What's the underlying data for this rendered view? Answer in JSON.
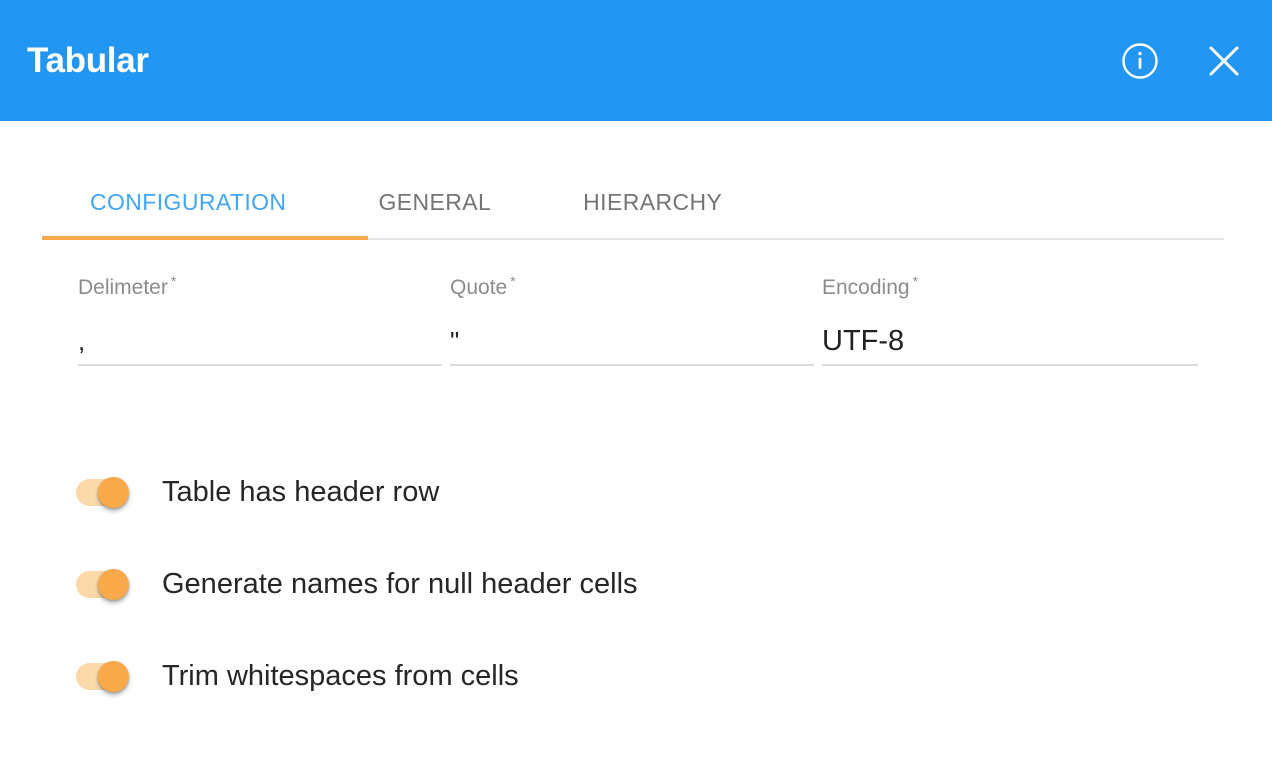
{
  "window": {
    "title": "Tabular",
    "info_icon": "info-circle-icon",
    "close_icon": "close-icon",
    "header_color": "#2196f3"
  },
  "tabs": [
    {
      "label": "CONFIGURATION",
      "active": true
    },
    {
      "label": "GENERAL",
      "active": false
    },
    {
      "label": "HIERARCHY",
      "active": false
    }
  ],
  "accent": {
    "tab_indicator_color": "#f9a94a",
    "active_tab_text_color": "#42a5f5",
    "inactive_tab_text_color": "#757575",
    "toggle_on_color": "#f9a94a",
    "toggle_track_color": "#fbd9a8"
  },
  "fields": [
    {
      "label": "Delimeter",
      "required_marker": "*",
      "value": ",",
      "placeholder": ""
    },
    {
      "label": "Quote",
      "required_marker": "*",
      "value": "\"",
      "placeholder": ""
    },
    {
      "label": "Encoding",
      "required_marker": "*",
      "value": "UTF-8",
      "placeholder": ""
    }
  ],
  "toggles": [
    {
      "label": "Table has header row",
      "on": true
    },
    {
      "label": "Generate names for null header cells",
      "on": true
    },
    {
      "label": "Trim whitespaces from cells",
      "on": true
    }
  ]
}
